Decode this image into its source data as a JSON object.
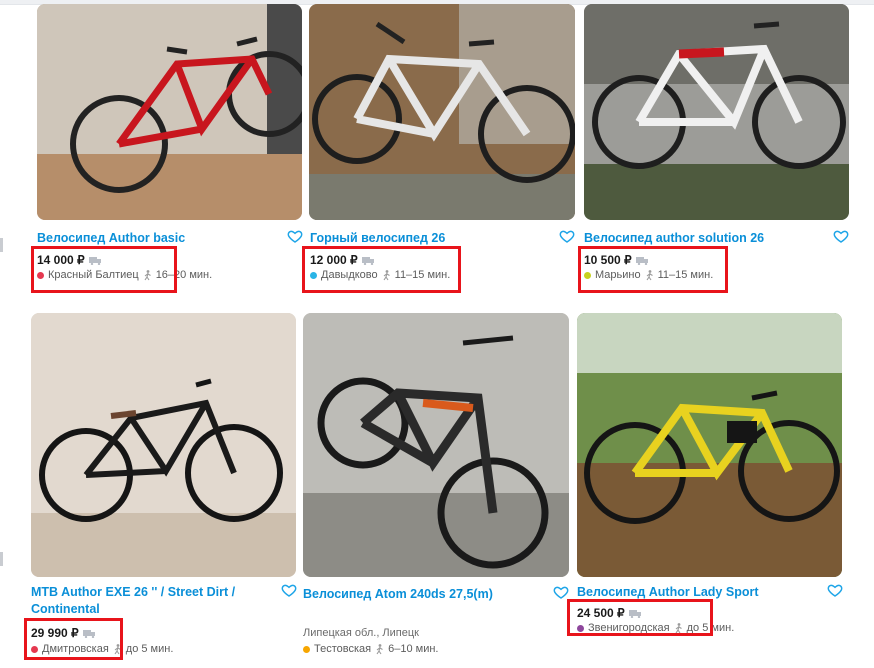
{
  "listings": [
    {
      "title": "Велосипед Author basic",
      "price": "14 000 ₽",
      "metro": "Красный Балтиец",
      "walk": "16–20 мин.",
      "metro_color": "#e53950",
      "icons": {
        "favorite": "heart-outline-icon",
        "delivery": "truck-icon",
        "walk": "walking-person-icon"
      }
    },
    {
      "title": "Горный велосипед 26",
      "price": "12 000 ₽",
      "metro": "Давыдково",
      "walk": "11–15 мин.",
      "metro_color": "#29b4e6"
    },
    {
      "title": "Велосипед author solution 26",
      "price": "10 500 ₽",
      "metro": "Марьино",
      "walk": "11–15 мин.",
      "metro_color": "#c7d21f"
    },
    {
      "title": "MTB Author EXE 26 '' / Street Dirt / Continental",
      "price": "29 990 ₽",
      "metro": "Дмитровская",
      "walk": "до 5 мин.",
      "metro_color": "#e53950"
    },
    {
      "title": "Велосипед Atom 240ds 27,5(m)",
      "price": "",
      "address": "Липецкая обл., Липецк",
      "metro": "Тестовская",
      "walk": "6–10 мин.",
      "metro_color": "#f7a600"
    },
    {
      "title": "Велосипед Author Lady Sport",
      "price": "24 500 ₽",
      "metro": "Звенигородская",
      "walk": "до 5 мин.",
      "metro_color": "#8e479c"
    }
  ],
  "colors": {
    "title": "#0a8fd8",
    "highlight": "#e8141b"
  }
}
